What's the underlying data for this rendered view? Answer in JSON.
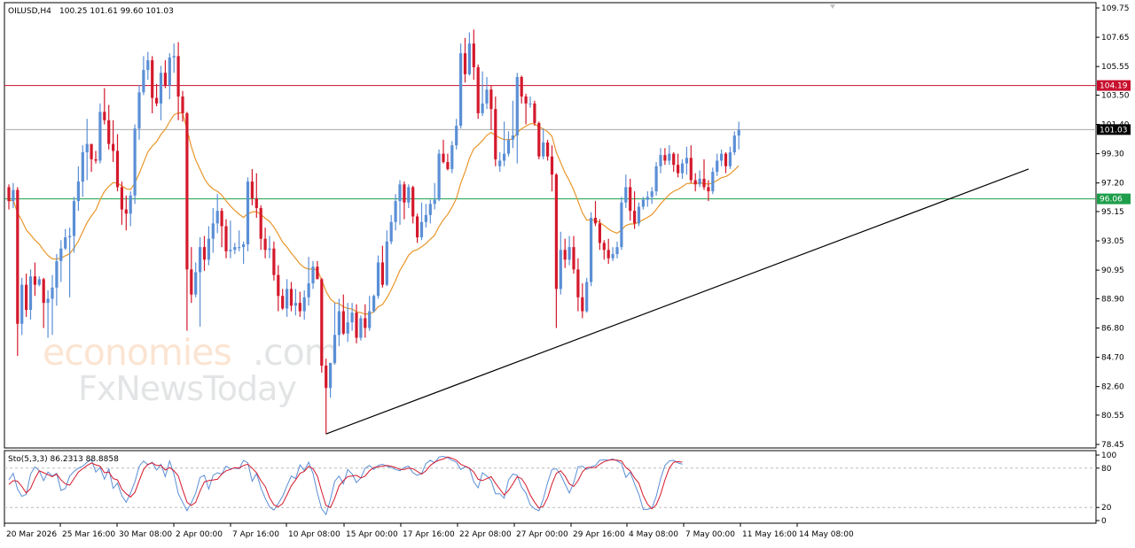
{
  "chart_data": {
    "type": "candlestick",
    "title": "OILUSD,H4",
    "ohlc_header": "100.25 101.61 99.60 101.03",
    "y_ticks": [
      "109.75",
      "107.65",
      "105.55",
      "103.50",
      "101.40",
      "99.30",
      "97.20",
      "95.15",
      "93.05",
      "90.95",
      "88.90",
      "86.80",
      "84.70",
      "82.60",
      "80.55",
      "78.45"
    ],
    "ylim": [
      78.45,
      109.75
    ],
    "x_ticks": [
      "20 Mar 2026",
      "25 Mar 16:00",
      "30 Mar 08:00",
      "2 Apr 00:00",
      "7 Apr 16:00",
      "10 Apr 08:00",
      "15 Apr 00:00",
      "17 Apr 16:00",
      "22 Apr 08:00",
      "27 Apr 00:00",
      "29 Apr 16:00",
      "4 May 08:00",
      "7 May 00:00",
      "11 May 16:00",
      "14 May 08:00"
    ],
    "levels": [
      {
        "label": "104.19",
        "value": 104.19,
        "color": "#c8102e"
      },
      {
        "label": "101.03",
        "value": 101.03,
        "color": "#000000"
      },
      {
        "label": "96.06",
        "value": 96.06,
        "color": "#1e9e4a"
      }
    ],
    "up_color": "#5b8fd6",
    "down_color": "#d4192c",
    "ma_color": "#e8962a",
    "trendline": {
      "from": [
        0,
        79.2
      ],
      "to": [
        1,
        98.2
      ]
    },
    "candles": [
      [
        96.9,
        97.1,
        95.3,
        95.9
      ],
      [
        95.9,
        97.2,
        95.4,
        96.7
      ],
      [
        96.7,
        96.9,
        84.8,
        87.1
      ],
      [
        87.1,
        90.4,
        86.3,
        89.9
      ],
      [
        89.9,
        90.7,
        87.6,
        88.1
      ],
      [
        88.1,
        91.0,
        87.4,
        90.5
      ],
      [
        90.5,
        91.5,
        89.1,
        89.9
      ],
      [
        89.9,
        90.5,
        89.8,
        90.3
      ],
      [
        90.3,
        90.4,
        86.8,
        88.6
      ],
      [
        88.6,
        89.5,
        86.1,
        88.9
      ],
      [
        88.9,
        90.6,
        86.3,
        89.7
      ],
      [
        89.7,
        92.1,
        88.4,
        91.6
      ],
      [
        91.6,
        93.1,
        90.1,
        92.5
      ],
      [
        92.5,
        93.9,
        92.4,
        93.3
      ],
      [
        93.3,
        94.0,
        89.0,
        93.4
      ],
      [
        93.4,
        96.2,
        92.2,
        95.9
      ],
      [
        95.9,
        98.4,
        95.2,
        97.3
      ],
      [
        97.3,
        99.9,
        96.2,
        99.4
      ],
      [
        99.4,
        101.8,
        97.4,
        100.0
      ],
      [
        100.0,
        100.0,
        98.0,
        98.9
      ],
      [
        98.9,
        99.5,
        98.6,
        98.8
      ],
      [
        98.8,
        102.9,
        98.6,
        102.3
      ],
      [
        102.3,
        104.0,
        101.4,
        101.7
      ],
      [
        101.7,
        102.8,
        99.6,
        100.0
      ],
      [
        100.0,
        101.7,
        98.7,
        99.5
      ],
      [
        99.5,
        100.7,
        96.6,
        96.9
      ],
      [
        96.9,
        97.3,
        94.2,
        95.3
      ],
      [
        95.3,
        96.3,
        93.8,
        95.0
      ],
      [
        95.0,
        96.6,
        94.1,
        96.3
      ],
      [
        96.3,
        101.4,
        95.7,
        101.1
      ],
      [
        101.1,
        104.2,
        100.3,
        103.7
      ],
      [
        103.7,
        106.3,
        103.5,
        105.3
      ],
      [
        105.3,
        106.6,
        104.6,
        106.0
      ],
      [
        106.0,
        106.3,
        102.2,
        103.3
      ],
      [
        103.3,
        104.3,
        102.7,
        102.9
      ],
      [
        102.9,
        105.6,
        101.7,
        105.1
      ],
      [
        105.1,
        106.0,
        104.0,
        104.2
      ],
      [
        104.2,
        106.5,
        103.2,
        106.2
      ],
      [
        106.2,
        107.2,
        105.1,
        106.3
      ],
      [
        106.3,
        107.3,
        101.7,
        103.4
      ],
      [
        103.4,
        103.8,
        101.6,
        102.2
      ],
      [
        102.2,
        102.3,
        86.6,
        91.0
      ],
      [
        91.0,
        92.6,
        88.6,
        89.2
      ],
      [
        89.2,
        91.5,
        89.0,
        90.8
      ],
      [
        90.8,
        93.3,
        86.9,
        92.6
      ],
      [
        92.6,
        93.4,
        90.9,
        91.7
      ],
      [
        91.7,
        94.1,
        91.3,
        93.2
      ],
      [
        93.2,
        95.4,
        92.2,
        94.3
      ],
      [
        94.3,
        96.4,
        93.6,
        95.2
      ],
      [
        95.2,
        95.4,
        92.6,
        94.1
      ],
      [
        94.1,
        94.6,
        91.8,
        92.3
      ],
      [
        92.3,
        94.5,
        91.8,
        92.4
      ],
      [
        92.4,
        92.9,
        92.1,
        92.6
      ],
      [
        92.6,
        93.8,
        92.3,
        92.6
      ],
      [
        92.6,
        93.0,
        91.4,
        92.8
      ],
      [
        92.8,
        97.6,
        92.3,
        97.3
      ],
      [
        97.3,
        98.2,
        95.6,
        96.1
      ],
      [
        96.1,
        97.9,
        94.7,
        95.4
      ],
      [
        95.4,
        95.6,
        92.4,
        93.2
      ],
      [
        93.2,
        94.0,
        91.8,
        92.4
      ],
      [
        92.4,
        93.4,
        91.8,
        92.5
      ],
      [
        92.5,
        93.0,
        90.2,
        90.6
      ],
      [
        90.6,
        91.3,
        88.0,
        89.1
      ],
      [
        89.1,
        89.6,
        88.1,
        88.2
      ],
      [
        88.2,
        90.3,
        87.6,
        89.6
      ],
      [
        89.6,
        90.1,
        88.0,
        88.4
      ],
      [
        88.4,
        89.6,
        87.7,
        88.6
      ],
      [
        88.6,
        89.4,
        87.6,
        88.0
      ],
      [
        88.0,
        89.5,
        87.4,
        89.0
      ],
      [
        89.0,
        91.9,
        88.4,
        90.0
      ],
      [
        90.0,
        91.6,
        89.6,
        91.2
      ],
      [
        91.2,
        91.6,
        90.3,
        90.3
      ],
      [
        90.3,
        90.4,
        83.6,
        84.1
      ],
      [
        84.1,
        84.6,
        79.2,
        82.5
      ],
      [
        82.5,
        84.3,
        81.8,
        84.3
      ],
      [
        84.3,
        88.6,
        84.2,
        86.3
      ],
      [
        86.3,
        88.9,
        85.5,
        88.0
      ],
      [
        88.0,
        89.2,
        86.3,
        86.4
      ],
      [
        86.4,
        88.6,
        85.8,
        87.2
      ],
      [
        87.2,
        88.6,
        86.6,
        87.9
      ],
      [
        87.9,
        88.5,
        85.7,
        86.1
      ],
      [
        86.1,
        87.7,
        85.9,
        87.5
      ],
      [
        87.5,
        88.5,
        86.1,
        86.8
      ],
      [
        86.8,
        89.1,
        86.6,
        88.0
      ],
      [
        88.0,
        89.2,
        87.9,
        89.1
      ],
      [
        89.1,
        92.0,
        88.9,
        91.5
      ],
      [
        91.5,
        92.7,
        89.7,
        89.9
      ],
      [
        89.9,
        93.8,
        89.8,
        93.0
      ],
      [
        93.0,
        94.9,
        92.8,
        94.4
      ],
      [
        94.4,
        96.4,
        93.8,
        95.9
      ],
      [
        95.9,
        97.4,
        94.2,
        97.1
      ],
      [
        97.1,
        97.3,
        94.6,
        95.8
      ],
      [
        95.8,
        97.1,
        95.4,
        96.9
      ],
      [
        96.9,
        97.0,
        94.3,
        94.8
      ],
      [
        94.8,
        95.0,
        92.9,
        93.3
      ],
      [
        93.3,
        95.8,
        93.1,
        94.4
      ],
      [
        94.4,
        95.7,
        94.0,
        94.9
      ],
      [
        94.9,
        96.0,
        94.3,
        95.7
      ],
      [
        95.7,
        97.2,
        95.3,
        96.0
      ],
      [
        96.0,
        99.6,
        95.9,
        99.3
      ],
      [
        99.3,
        100.3,
        98.6,
        98.7
      ],
      [
        98.7,
        99.3,
        98.1,
        98.2
      ],
      [
        98.2,
        100.2,
        97.9,
        99.9
      ],
      [
        99.9,
        101.8,
        99.6,
        101.3
      ],
      [
        101.3,
        107.2,
        101.1,
        106.5
      ],
      [
        106.5,
        107.6,
        104.4,
        105.0
      ],
      [
        105.0,
        108.0,
        104.9,
        107.2
      ],
      [
        107.2,
        108.2,
        104.6,
        105.5
      ],
      [
        105.5,
        105.7,
        101.8,
        102.2
      ],
      [
        102.2,
        105.2,
        102.0,
        102.9
      ],
      [
        102.9,
        104.8,
        102.5,
        103.9
      ],
      [
        103.9,
        104.2,
        101.0,
        102.5
      ],
      [
        102.5,
        103.4,
        98.4,
        98.9
      ],
      [
        98.4,
        99.4,
        98.0,
        98.8
      ],
      [
        98.8,
        101.6,
        98.4,
        99.3
      ],
      [
        99.3,
        100.9,
        99.1,
        100.3
      ],
      [
        100.3,
        103.1,
        99.7,
        100.6
      ],
      [
        100.6,
        105.1,
        98.6,
        104.8
      ],
      [
        104.8,
        104.9,
        102.9,
        103.4
      ],
      [
        103.4,
        103.6,
        101.4,
        102.9
      ],
      [
        102.9,
        103.4,
        102.6,
        102.9
      ],
      [
        102.9,
        103.1,
        101.3,
        101.5
      ],
      [
        101.5,
        101.6,
        98.9,
        99.1
      ],
      [
        99.1,
        101.1,
        98.9,
        100.1
      ],
      [
        100.1,
        100.3,
        98.8,
        99.1
      ],
      [
        99.1,
        99.9,
        96.6,
        97.8
      ],
      [
        97.8,
        97.9,
        86.8,
        89.6
      ],
      [
        89.6,
        93.7,
        89.2,
        92.4
      ],
      [
        92.4,
        93.2,
        91.1,
        91.7
      ],
      [
        91.7,
        93.4,
        91.3,
        92.6
      ],
      [
        92.6,
        93.4,
        90.7,
        91.0
      ],
      [
        91.0,
        91.8,
        88.0,
        89.0
      ],
      [
        89.0,
        90.0,
        87.5,
        88.0
      ],
      [
        88.0,
        90.4,
        87.9,
        90.1
      ],
      [
        90.1,
        95.1,
        89.8,
        94.7
      ],
      [
        94.7,
        95.9,
        94.1,
        94.3
      ],
      [
        94.3,
        94.6,
        92.4,
        92.9
      ],
      [
        92.9,
        93.1,
        91.7,
        92.4
      ],
      [
        92.4,
        93.2,
        91.4,
        91.8
      ],
      [
        91.8,
        92.6,
        91.6,
        92.1
      ],
      [
        92.1,
        93.0,
        91.8,
        92.6
      ],
      [
        92.6,
        96.2,
        92.4,
        95.8
      ],
      [
        95.8,
        97.8,
        95.4,
        96.9
      ],
      [
        96.9,
        97.5,
        94.5,
        95.2
      ],
      [
        95.2,
        96.6,
        93.9,
        94.3
      ],
      [
        94.3,
        95.8,
        94.1,
        95.5
      ],
      [
        95.5,
        96.2,
        95.3,
        96.0
      ],
      [
        96.0,
        96.6,
        95.5,
        96.2
      ],
      [
        96.2,
        96.9,
        95.7,
        96.6
      ],
      [
        96.6,
        98.7,
        96.3,
        98.4
      ],
      [
        98.4,
        99.7,
        97.9,
        99.2
      ],
      [
        99.2,
        99.7,
        98.5,
        98.8
      ],
      [
        98.8,
        99.9,
        98.5,
        99.3
      ],
      [
        99.3,
        99.4,
        98.0,
        98.5
      ],
      [
        98.5,
        99.3,
        97.6,
        97.9
      ],
      [
        97.9,
        98.9,
        97.5,
        98.6
      ],
      [
        98.6,
        99.8,
        97.8,
        99.0
      ],
      [
        99.0,
        99.9,
        97.2,
        97.4
      ],
      [
        97.4,
        97.9,
        96.6,
        97.1
      ],
      [
        97.1,
        98.1,
        96.9,
        97.5
      ],
      [
        97.5,
        98.9,
        96.7,
        96.9
      ],
      [
        96.9,
        97.4,
        95.9,
        96.6
      ],
      [
        96.6,
        98.3,
        96.4,
        98.0
      ],
      [
        98.0,
        99.3,
        97.7,
        98.8
      ],
      [
        98.8,
        99.6,
        98.4,
        99.3
      ],
      [
        99.3,
        99.4,
        97.9,
        98.4
      ],
      [
        98.4,
        99.8,
        98.2,
        99.4
      ],
      [
        99.4,
        100.9,
        99.2,
        100.6
      ],
      [
        100.6,
        101.6,
        99.6,
        101.0
      ]
    ]
  },
  "oscillator": {
    "label": "Sto(5,3,3) 86.2313 88.8858",
    "ticks": [
      "100",
      "80",
      "20",
      "0"
    ],
    "levels": [
      80,
      20
    ],
    "main_color": "#5b8fd6",
    "signal_color": "#d4192c",
    "values": [
      62,
      72,
      48,
      37,
      40,
      71,
      82,
      76,
      61,
      74,
      68,
      72,
      46,
      49,
      68,
      75,
      80,
      83,
      89,
      93,
      74,
      81,
      63,
      79,
      49,
      57,
      38,
      28,
      42,
      59,
      83,
      91,
      85,
      89,
      77,
      86,
      67,
      91,
      71,
      41,
      28,
      15,
      27,
      42,
      66,
      69,
      48,
      69,
      73,
      71,
      83,
      79,
      80,
      79,
      92,
      88,
      60,
      72,
      50,
      34,
      21,
      16,
      26,
      37,
      53,
      68,
      64,
      85,
      76,
      89,
      72,
      42,
      18,
      9,
      32,
      60,
      68,
      56,
      78,
      71,
      58,
      65,
      80,
      84,
      78,
      84,
      86,
      83,
      81,
      78,
      76,
      81,
      83,
      73,
      69,
      72,
      87,
      92,
      88,
      97,
      98,
      96,
      92,
      89,
      78,
      82,
      80,
      59,
      50,
      73,
      68,
      61,
      41,
      41,
      34,
      62,
      71,
      69,
      51,
      42,
      24,
      18,
      15,
      33,
      58,
      78,
      79,
      70,
      56,
      42,
      58,
      82,
      83,
      78,
      82,
      84,
      92,
      93,
      92,
      94,
      91,
      87,
      66,
      74,
      56,
      40,
      17,
      17,
      19,
      37,
      64,
      84,
      91,
      92,
      88,
      86
    ],
    "signal": [
      55,
      61,
      60,
      52,
      42,
      49,
      64,
      76,
      73,
      70,
      67,
      71,
      62,
      56,
      54,
      64,
      74,
      79,
      84,
      88,
      85,
      83,
      73,
      74,
      64,
      62,
      48,
      41,
      36,
      43,
      61,
      78,
      86,
      88,
      84,
      84,
      77,
      81,
      76,
      68,
      47,
      28,
      23,
      28,
      45,
      59,
      61,
      62,
      63,
      71,
      76,
      78,
      81,
      80,
      84,
      86,
      80,
      73,
      61,
      52,
      35,
      24,
      21,
      26,
      39,
      53,
      62,
      72,
      75,
      83,
      79,
      68,
      44,
      23,
      20,
      34,
      53,
      61,
      67,
      68,
      69,
      65,
      68,
      76,
      81,
      82,
      83,
      84,
      83,
      81,
      78,
      78,
      80,
      79,
      75,
      71,
      76,
      84,
      89,
      92,
      94,
      97,
      95,
      92,
      86,
      83,
      80,
      74,
      63,
      61,
      64,
      67,
      57,
      48,
      39,
      46,
      56,
      67,
      64,
      54,
      39,
      28,
      19,
      22,
      35,
      56,
      72,
      76,
      68,
      56,
      52,
      61,
      74,
      81,
      81,
      81,
      86,
      90,
      92,
      93,
      92,
      91,
      81,
      76,
      65,
      57,
      38,
      25,
      18,
      24,
      40,
      62,
      80,
      89,
      90,
      89
    ]
  }
}
